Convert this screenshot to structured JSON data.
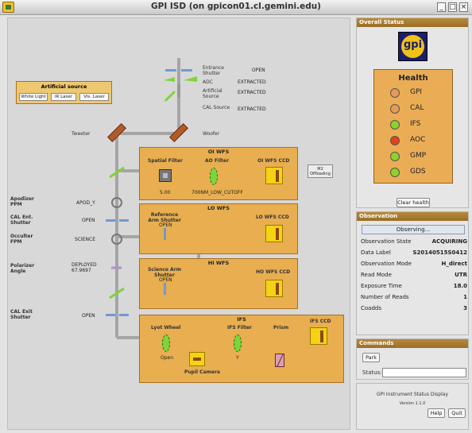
{
  "window": {
    "title": "GPI ISD (on gpicon01.cl.gemini.edu)"
  },
  "artificial_source": {
    "title": "Artificial source",
    "buttons": [
      "White Light",
      "IR Laser",
      "Vis. Laser"
    ]
  },
  "top_components": [
    {
      "label": "Entrance Shutter",
      "value": "OPEN"
    },
    {
      "label": "ADC",
      "value": "EXTRACTED"
    },
    {
      "label": "Artificial Source",
      "value": "EXTRACTED"
    },
    {
      "label": "CAL Source",
      "value": "EXTRACTED"
    }
  ],
  "mirrors": {
    "tweeter": "Tweeter",
    "woofer": "Woofer"
  },
  "side_labels": {
    "apodizer": {
      "label": "Apodizer PPM",
      "value": "APOD_Y"
    },
    "cal_ent": {
      "label": "CAL Ent. Shutter",
      "value": "OPEN"
    },
    "occulter": {
      "label": "Occulter FPM",
      "value": "SCIENCE"
    },
    "polarizer": {
      "label": "Polarizer Angle",
      "value": "DEPLOYED",
      "value2": "67.9697"
    },
    "cal_exit": {
      "label": "CAL Exit Shutter",
      "value": "OPEN"
    }
  },
  "oiwfs": {
    "title": "OI WFS",
    "spatial_filter": "Spatial Filter",
    "spatial_value": "5.00",
    "ao_filter": "AO Filter",
    "ao_value": "700NM_LOW_CUTOFF",
    "ccd": "OI WFS CCD"
  },
  "m2_button": "M2 Offloading",
  "lowfs": {
    "title": "LO WFS",
    "shutter": "Reference Arm Shutter",
    "shutter_value": "OPEN",
    "ccd": "LO WFS CCD"
  },
  "hiwfs": {
    "title": "HI WFS",
    "shutter": "Science Arm Shutter",
    "shutter_value": "OPEN",
    "ccd": "HO WFS CCD"
  },
  "ifs": {
    "title": "IFS",
    "lyot": "Lyot Wheel",
    "lyot_value": "Open",
    "filter": "IFS Filter",
    "filter_value": "Y",
    "prism": "Prism",
    "ccd": "IFS CCD",
    "pupil": "Pupil Camera"
  },
  "overall_status": {
    "heading": "Overall Status",
    "logo": "gpi",
    "health_title": "Health",
    "items": [
      {
        "name": "GPI",
        "color": "#e89a5a"
      },
      {
        "name": "CAL",
        "color": "#e89a5a"
      },
      {
        "name": "IFS",
        "color": "#8fd12e"
      },
      {
        "name": "AOC",
        "color": "#e2421c"
      },
      {
        "name": "GMP",
        "color": "#8fd12e"
      },
      {
        "name": "GDS",
        "color": "#8fd12e"
      }
    ],
    "clear_button": "Clear health"
  },
  "observation": {
    "heading": "Observation",
    "progress_label": "Observing...",
    "rows": [
      {
        "key": "Observation State",
        "value": "ACQUIRING"
      },
      {
        "key": "Data Label",
        "value": "S20140515S0412"
      },
      {
        "key": "Observation Mode",
        "value": "H_direct"
      },
      {
        "key": "Read Mode",
        "value": "UTR"
      },
      {
        "key": "Exposure Time",
        "value": "18.0"
      },
      {
        "key": "Number of Reads",
        "value": "1"
      },
      {
        "key": "Coadds",
        "value": "3"
      }
    ]
  },
  "commands": {
    "heading": "Commands",
    "park_button": "Park",
    "status_label": "Status:",
    "status_value": ""
  },
  "footer": {
    "app_name": "GPI Instrument Status Display",
    "version": "Version 1.1.0",
    "help_button": "Help",
    "quit_button": "Quit"
  },
  "colors": {
    "subsystem_box": "#e8ae50",
    "beam": "#a5a5a5",
    "ccd": "#f5d215",
    "filter_green": "#7fd33c",
    "panel_header": "#a8782e"
  }
}
